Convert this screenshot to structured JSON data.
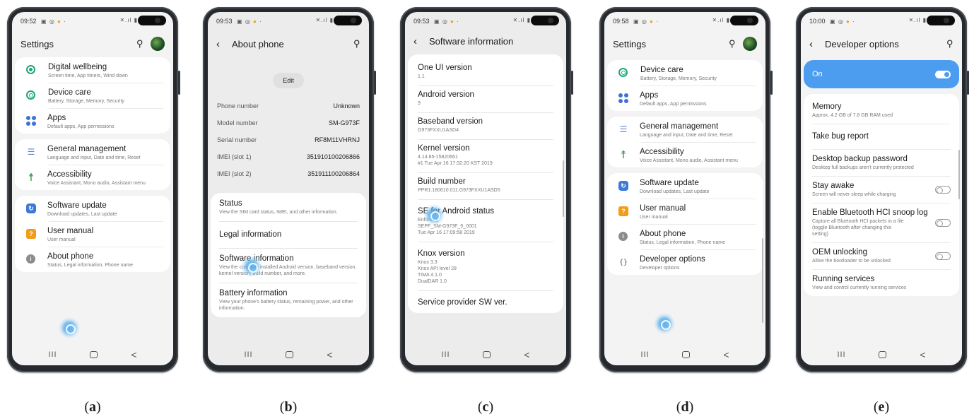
{
  "nav": {
    "recent": "III",
    "back": "<"
  },
  "panels": {
    "a": {
      "time": "09:52",
      "title": "Settings",
      "caption": "a",
      "cards": [
        [
          {
            "title": "Digital wellbeing",
            "sub": "Screen time, App timers, Wind down",
            "icon": "digital-wellbeing-icon"
          },
          {
            "title": "Device care",
            "sub": "Battery, Storage, Memory, Security",
            "icon": "device-care-icon"
          },
          {
            "title": "Apps",
            "sub": "Default apps, App permissions",
            "icon": "apps-icon"
          }
        ],
        [
          {
            "title": "General management",
            "sub": "Language and input, Date and time, Reset",
            "icon": "general-management-icon"
          },
          {
            "title": "Accessibility",
            "sub": "Voice Assistant, Mono audio, Assistant menu",
            "icon": "accessibility-icon"
          }
        ],
        [
          {
            "title": "Software update",
            "sub": "Download updates, Last update",
            "icon": "software-update-icon"
          },
          {
            "title": "User manual",
            "sub": "User manual",
            "icon": "user-manual-icon"
          },
          {
            "title": "About phone",
            "sub": "Status, Legal information, Phone name",
            "icon": "about-phone-icon"
          }
        ]
      ]
    },
    "b": {
      "time": "09:53",
      "title": "About phone",
      "caption": "b",
      "edit": "Edit",
      "info": [
        {
          "k": "Phone number",
          "v": "Unknown"
        },
        {
          "k": "Model number",
          "v": "SM-G973F"
        },
        {
          "k": "Serial number",
          "v": "RF8M11VHRNJ"
        },
        {
          "k": "IMEI (slot 1)",
          "v": "351910100206866"
        },
        {
          "k": "IMEI (slot 2)",
          "v": "351911100206864"
        }
      ],
      "items": [
        {
          "title": "Status",
          "sub": "View the SIM card status, IMEI, and other information."
        },
        {
          "title": "Legal information",
          "sub": ""
        },
        {
          "title": "Software information",
          "sub": "View the currently installed Android version, baseband version, kernel version, build number, and more."
        },
        {
          "title": "Battery information",
          "sub": "View your phone's battery status, remaining power, and other information."
        }
      ]
    },
    "c": {
      "time": "09:53",
      "title": "Software information",
      "caption": "c",
      "items": [
        {
          "title": "One UI version",
          "sub": "1.1"
        },
        {
          "title": "Android version",
          "sub": "9"
        },
        {
          "title": "Baseband version",
          "sub": "G973FXXU1ASD4"
        },
        {
          "title": "Kernel version",
          "sub": "4.14.85-15820661\n#1 Tue Apr 16 17:32:20 KST 2019"
        },
        {
          "title": "Build number",
          "sub": "PPR1.180610.011.G973FXXU1ASD5"
        },
        {
          "title": "SE for Android status",
          "sub": "Enforcing\nSEPF_SM-G973F_9_0001\nTue Apr 16 17:09:58 2019"
        },
        {
          "title": "Knox version",
          "sub": "Knox 3.3\nKnox API level 28\nTIMA 4.1.0\nDualDAR 1.0"
        },
        {
          "title": "Service provider SW ver.",
          "sub": ""
        }
      ]
    },
    "d": {
      "time": "09:58",
      "title": "Settings",
      "caption": "d",
      "cards": [
        [
          {
            "title": "Device care",
            "sub": "Battery, Storage, Memory, Security",
            "icon": "device-care-icon"
          },
          {
            "title": "Apps",
            "sub": "Default apps, App permissions",
            "icon": "apps-icon"
          }
        ],
        [
          {
            "title": "General management",
            "sub": "Language and input, Date and time, Reset",
            "icon": "general-management-icon"
          },
          {
            "title": "Accessibility",
            "sub": "Voice Assistant, Mono audio, Assistant menu",
            "icon": "accessibility-icon"
          }
        ],
        [
          {
            "title": "Software update",
            "sub": "Download updates, Last update",
            "icon": "software-update-icon"
          },
          {
            "title": "User manual",
            "sub": "User manual",
            "icon": "user-manual-icon"
          },
          {
            "title": "About phone",
            "sub": "Status, Legal information, Phone name",
            "icon": "about-phone-icon"
          },
          {
            "title": "Developer options",
            "sub": "Developer options",
            "icon": "developer-options-icon"
          }
        ]
      ]
    },
    "e": {
      "time": "10:00",
      "title": "Developer options",
      "caption": "e",
      "master": "On",
      "items": [
        {
          "title": "Memory",
          "sub": "Approx. 4.2 GB of 7.8 GB RAM used",
          "toggle": false
        },
        {
          "title": "Take bug report",
          "sub": "",
          "toggle": false
        },
        {
          "title": "Desktop backup password",
          "sub": "Desktop full backups aren't currently protected",
          "toggle": false
        },
        {
          "title": "Stay awake",
          "sub": "Screen will never sleep while charging",
          "toggle": true
        },
        {
          "title": "Enable Bluetooth HCI snoop log",
          "sub": "Capture all Bluetooth HCI packets in a file (toggle Bluetooth after changing this setting)",
          "toggle": true
        },
        {
          "title": "OEM unlocking",
          "sub": "Allow the bootloader to be unlocked",
          "toggle": true
        },
        {
          "title": "Running services",
          "sub": "View and control currently running services",
          "toggle": false
        }
      ]
    }
  }
}
